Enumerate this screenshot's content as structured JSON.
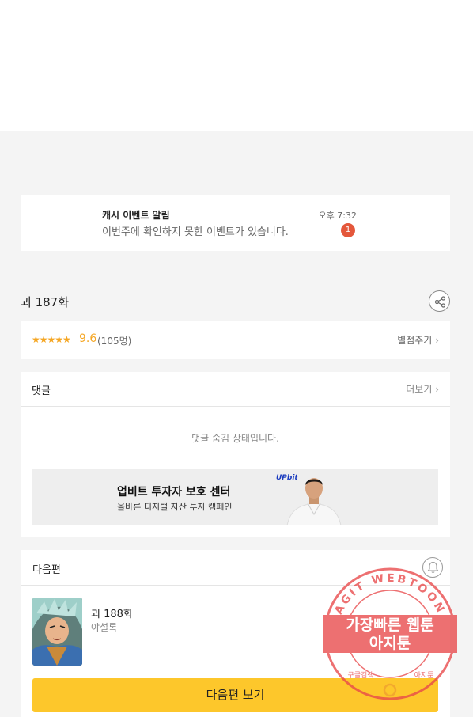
{
  "notification": {
    "title": "캐시 이벤트 알림",
    "message": "이번주에 확인하지 못한 이벤트가 있습니다.",
    "time": "오후 7:32",
    "badge": "1"
  },
  "episode": {
    "title": "괴 187화",
    "rating": {
      "stars": "★★★★★",
      "score": "9.6",
      "count": "(105명)",
      "rate_link": "별점주기"
    }
  },
  "comments": {
    "title": "댓글",
    "more": "더보기",
    "hidden_message": "댓글 숨김 상태입니다."
  },
  "ad": {
    "brand": "UPbit",
    "title": "업비트 투자자 보호 센터",
    "subtitle": "올바른 디지털 자산 투자 캠페인"
  },
  "next_episode": {
    "section_title": "다음편",
    "title": "괴 188화",
    "author": "야설록",
    "button": "다음편 보기"
  },
  "watermark": {
    "ring_text": "AGIT WEBTOON",
    "line1": "가장빠른 웹툰",
    "line2": "아지툰",
    "bottom_left": "구글검색",
    "bottom_right": "아지툰"
  },
  "colors": {
    "accent_yellow": "#fdc72b",
    "star_orange": "#f5a623",
    "badge_red": "#e4573b",
    "stamp_red": "#e8484a"
  }
}
